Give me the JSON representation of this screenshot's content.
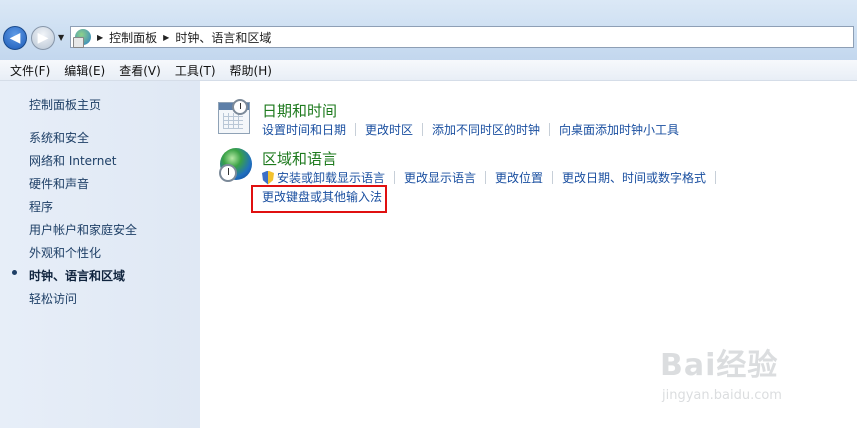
{
  "breadcrumb": {
    "items": [
      "控制面板",
      "时钟、语言和区域"
    ]
  },
  "menu": {
    "items": [
      "文件(F)",
      "编辑(E)",
      "查看(V)",
      "工具(T)",
      "帮助(H)"
    ]
  },
  "sidebar": {
    "home": "控制面板主页",
    "items": [
      "系统和安全",
      "网络和 Internet",
      "硬件和声音",
      "程序",
      "用户帐户和家庭安全",
      "外观和个性化",
      "时钟、语言和区域",
      "轻松访问"
    ],
    "current": "时钟、语言和区域"
  },
  "sections": [
    {
      "title": "日期和时间",
      "icon": "calendar-clock-icon",
      "tasks": [
        "设置时间和日期",
        "更改时区",
        "添加不同时区的时钟",
        "向桌面添加时钟小工具"
      ]
    },
    {
      "title": "区域和语言",
      "icon": "globe-clock-icon",
      "tasks": [
        "安装或卸载显示语言",
        "更改显示语言",
        "更改位置",
        "更改日期、时间或数字格式",
        "更改键盘或其他输入法"
      ]
    }
  ],
  "highlight_color": "#e01010",
  "watermark": {
    "main": "Bai经验",
    "sub": "jingyan.baidu.com"
  }
}
